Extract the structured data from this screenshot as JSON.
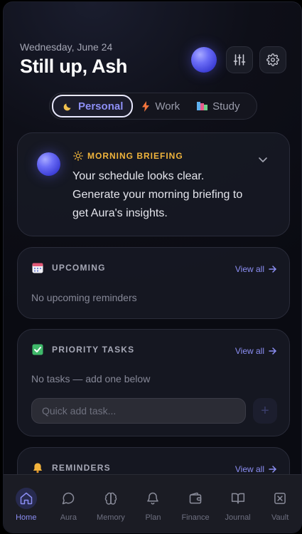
{
  "header": {
    "date": "Wednesday, June 24",
    "greeting": "Still up, Ash"
  },
  "modes": {
    "items": [
      {
        "label": "Personal",
        "icon": "moon-icon",
        "active": true
      },
      {
        "label": "Work",
        "icon": "lightning-icon",
        "active": false
      },
      {
        "label": "Study",
        "icon": "books-icon",
        "active": false
      }
    ]
  },
  "briefing": {
    "tag": "MORNING BRIEFING",
    "text": "Your schedule looks clear. Generate your morning briefing to get Aura's insights."
  },
  "upcoming": {
    "title": "UPCOMING",
    "view_all": "View all",
    "empty": "No upcoming reminders"
  },
  "priority": {
    "title": "PRIORITY TASKS",
    "view_all": "View all",
    "empty": "No tasks — add one below",
    "placeholder": "Quick add task...",
    "add_label": "+"
  },
  "reminders": {
    "title": "REMINDERS",
    "view_all": "View all"
  },
  "nav": {
    "items": [
      {
        "label": "Home",
        "icon": "home-icon",
        "active": true
      },
      {
        "label": "Aura",
        "icon": "chat-bubble-icon",
        "active": false
      },
      {
        "label": "Memory",
        "icon": "brain-icon",
        "active": false
      },
      {
        "label": "Plan",
        "icon": "bell-icon",
        "active": false
      },
      {
        "label": "Finance",
        "icon": "wallet-icon",
        "active": false
      },
      {
        "label": "Journal",
        "icon": "book-icon",
        "active": false
      },
      {
        "label": "Vault",
        "icon": "vault-icon",
        "active": false
      }
    ]
  },
  "colors": {
    "accent": "#8b8ef3",
    "briefing_tag": "#f0b43c",
    "background": "#0e0f18"
  }
}
